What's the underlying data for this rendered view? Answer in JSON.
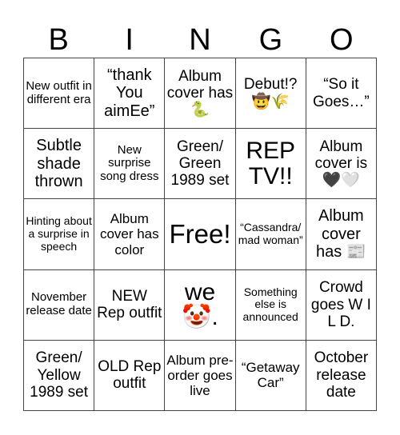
{
  "title_letters": [
    "B",
    "I",
    "N",
    "G",
    "O"
  ],
  "cells": [
    [
      "New outfit in different era",
      "“thank You aimEe”",
      "Album cover has 🐍",
      "Debut!? 🤠🌾",
      "“So it Goes…”"
    ],
    [
      "Subtle shade thrown",
      "New surprise song dress",
      "Green/ Green 1989 set",
      "REP TV!!",
      "Album cover is 🖤🤍"
    ],
    [
      "Hinting about a surprise in speech",
      "Album cover has color",
      "Free!",
      "“Cassandra/ mad woman”",
      "Album cover has 📰"
    ],
    [
      "November release date",
      "NEW Rep outfit",
      "we 🤡.",
      "Something else is announced",
      "Crowd goes W I L D."
    ],
    [
      "Green/ Yellow 1989 set",
      "OLD Rep outfit",
      "Album pre-order goes live",
      "“Getaway Car”",
      "October release date"
    ]
  ],
  "colors": {
    "grid_line": "#444444",
    "text": "#000000",
    "background": "#ffffff"
  }
}
